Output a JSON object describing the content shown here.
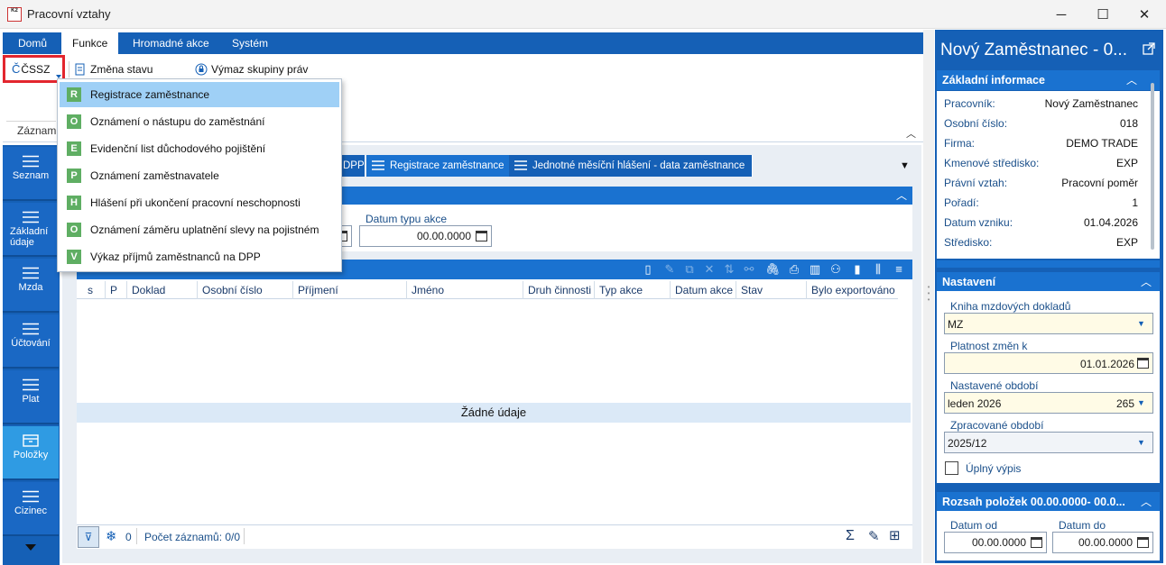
{
  "window": {
    "title": "Pracovní vztahy",
    "logo_text": "K2",
    "minimize": "─",
    "maximize": "☐",
    "close": "✕"
  },
  "menu_tabs": [
    "Domů",
    "Funkce",
    "Hromadné akce",
    "Systém"
  ],
  "active_menu_tab": "Funkce",
  "ribbon": {
    "cssz_label": "ČSSZ",
    "cssz_letter": "Č",
    "change_state_label": "Změna stavu",
    "remove_rights_label": "Výmaz skupiny práv",
    "group_label": "Záznam"
  },
  "left_nav": [
    {
      "label": "Seznam",
      "active": false
    },
    {
      "label": "Základní údaje",
      "active": false
    },
    {
      "label": "Mzda",
      "active": false
    },
    {
      "label": "Účtování",
      "active": false
    },
    {
      "label": "Plat",
      "active": false
    },
    {
      "label": "Položky",
      "active": true
    },
    {
      "label": "Cizinec",
      "active": false
    }
  ],
  "dropdown_menu": [
    {
      "letter": "R",
      "label": "Registrace zaměstnance",
      "hover": true
    },
    {
      "letter": "O",
      "label": "Oznámení o nástupu do zaměstnání",
      "hover": false
    },
    {
      "letter": "E",
      "label": "Evidenční list důchodového pojištění",
      "hover": false
    },
    {
      "letter": "P",
      "label": "Oznámení zaměstnavatele",
      "hover": false
    },
    {
      "letter": "H",
      "label": "Hlášení při ukončení pracovní neschopnosti",
      "hover": false
    },
    {
      "letter": "O",
      "label": "Oznámení záměru uplatnění slevy na pojistném",
      "hover": false
    },
    {
      "letter": "V",
      "label": "Výkaz příjmů zaměstnanců na DPP",
      "hover": false
    }
  ],
  "doc_tabs": [
    {
      "label": "DPP",
      "active": false
    },
    {
      "label": "Registrace zaměstnance",
      "active": true
    },
    {
      "label": "Jednotné měsíční hlášení - data zaměstnance",
      "active": false
    }
  ],
  "filter": {
    "datum_label": "Datum typu akce",
    "date_from": "",
    "date_value": "00.00.0000"
  },
  "grid": {
    "columns": [
      "s",
      "P",
      "Doklad",
      "Osobní číslo",
      "Příjmení",
      "Jméno",
      "Druh činnosti",
      "Typ akce",
      "Datum akce",
      "Stav",
      "Bylo exportováno"
    ],
    "empty_text": "Žádné údaje"
  },
  "status": {
    "count_zero": "0",
    "record_count": "Počet záznamů: 0/0"
  },
  "right_panel": {
    "title": "Nový Zaměstnanec - 0...",
    "basic_header": "Základní informace",
    "basic_info": [
      {
        "label": "Pracovník:",
        "value": "Nový Zaměstnanec"
      },
      {
        "label": "Osobní číslo:",
        "value": "018"
      },
      {
        "label": "Firma:",
        "value": "DEMO TRADE"
      },
      {
        "label": "Kmenové středisko:",
        "value": "EXP"
      },
      {
        "label": "Právní vztah:",
        "value": "Pracovní poměr"
      },
      {
        "label": "Pořadí:",
        "value": "1"
      },
      {
        "label": "Datum vzniku:",
        "value": "01.04.2026"
      },
      {
        "label": "Středisko:",
        "value": "EXP"
      }
    ],
    "settings_header": "Nastavení",
    "settings": {
      "book_label": "Kniha mzdových dokladů",
      "book_value": "MZ",
      "validity_label": "Platnost změn k",
      "validity_value": "01.01.2026",
      "period_label": "Nastavené období",
      "period_value": "leden 2026",
      "period_number": "265",
      "processed_label": "Zpracované období",
      "processed_value": "2025/12",
      "full_listing_label": "Úplný výpis",
      "full_listing_checked": false
    },
    "range_header": "Rozsah položek 00.00.0000- 00.0...",
    "range": {
      "from_label": "Datum od",
      "from_value": "00.00.0000",
      "to_label": "Datum do",
      "to_value": "00.00.0000"
    }
  },
  "icons": {
    "collapse_up": "chevron-up-icon",
    "calendar": "calendar-icon",
    "filter": "filter-icon"
  },
  "colors": {
    "brand_blue": "#1560b6",
    "section_blue": "#1a72d0",
    "active_nav": "#2f9be3",
    "highlight_red": "#e3262e",
    "menu_hover": "#9fd0f6",
    "letter_green": "#5fae63"
  }
}
